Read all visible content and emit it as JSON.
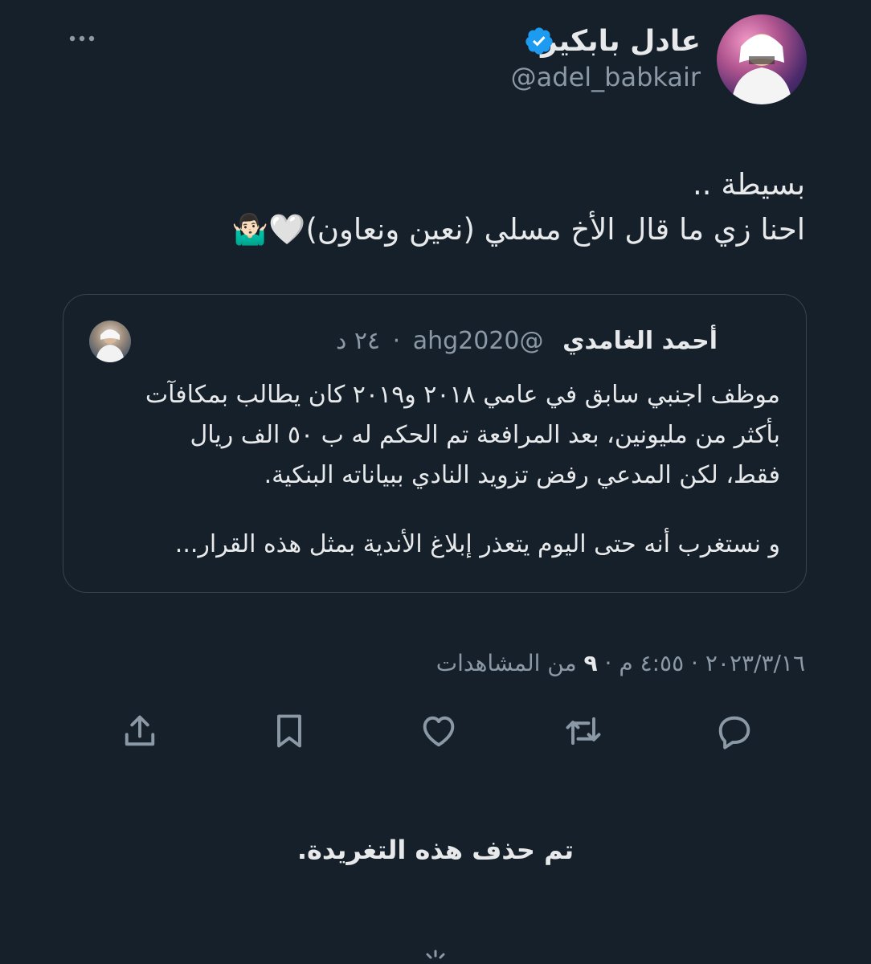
{
  "author": {
    "display_name": "عادل بابكير",
    "handle": "@adel_babkair"
  },
  "tweet": {
    "lines": [
      "بسيطة ..",
      "احنا زي ما قال الأخ مسلي (نعين ونعاون)🤍🤷🏻‍♂️"
    ]
  },
  "quoted": {
    "name": "أحمد الغامدي",
    "handle": "@ahg2020",
    "time": "٢٤ د",
    "lines": [
      "موظف اجنبي سابق في عامي ٢٠١٨ و٢٠١٩ كان يطالب بمكافآت",
      "بأكثر من مليونين، بعد المرافعة تم الحكم له ب ٥٠ الف ريال",
      "فقط، لكن المدعي رفض تزويد النادي ببياناته البنكية.",
      "و نستغرب أنه حتى اليوم يتعذر إبلاغ الأندية بمثل هذه القرار..."
    ]
  },
  "meta": {
    "date": "٢٠٢٣/٣/١٦",
    "time": "٤:٥٥ م",
    "views_count": "٩",
    "views_label": "من المشاهدات"
  },
  "actions": {
    "reply": "reply-icon",
    "retweet": "retweet-icon",
    "like": "heart-icon",
    "bookmark": "bookmark-icon",
    "share": "share-icon"
  },
  "deleted_notice": "تم حذف هذه التغريدة.",
  "colors": {
    "background": "#15202b",
    "text": "#e7e9ea",
    "secondary": "#8b98a5",
    "border": "#38444d",
    "verified": "#1d9bf0"
  }
}
